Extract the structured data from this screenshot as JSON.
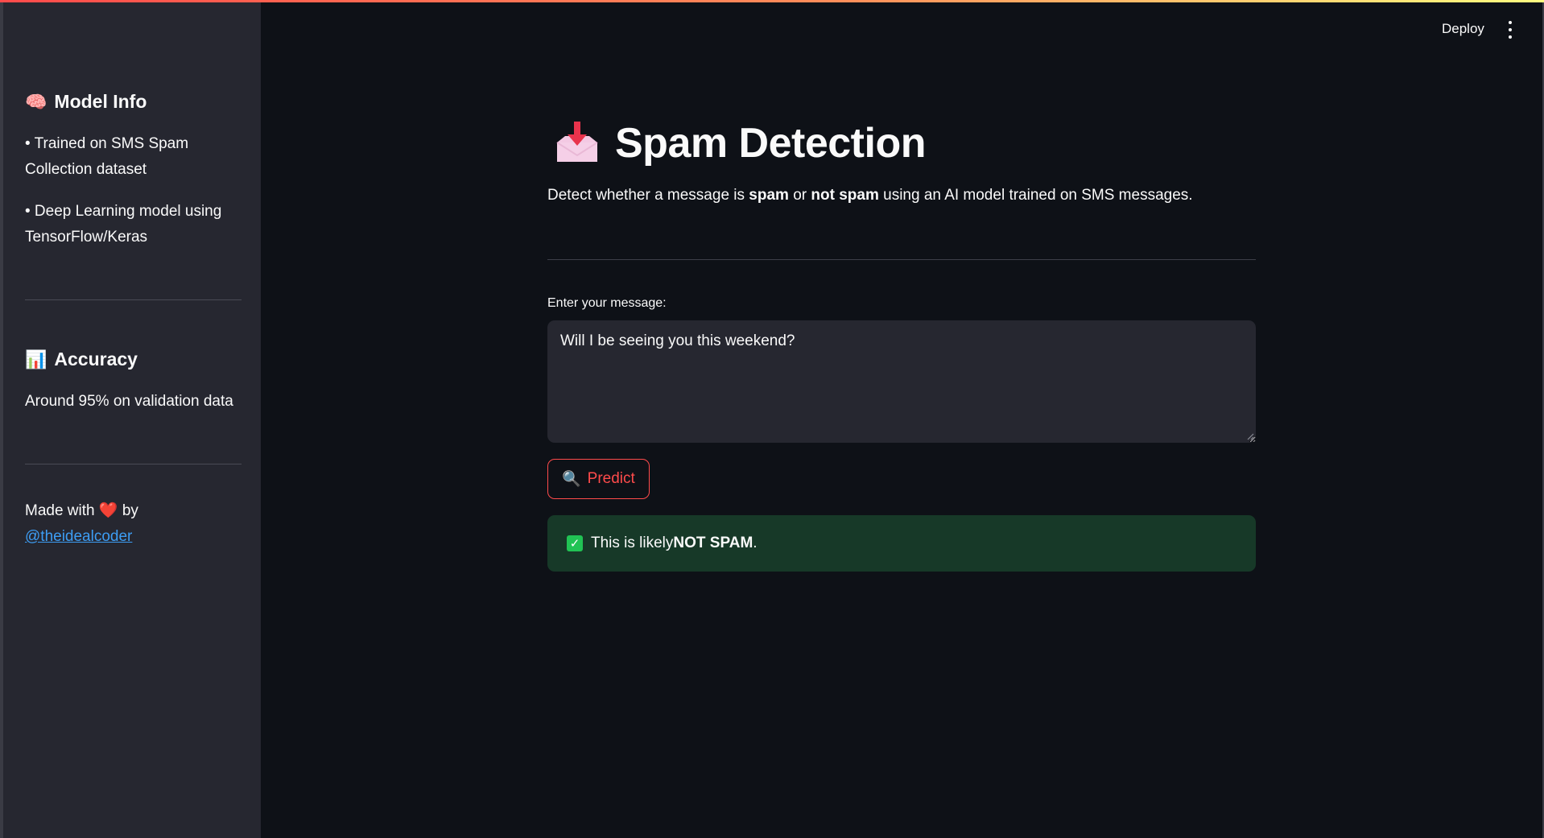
{
  "header": {
    "deploy_label": "Deploy",
    "menu_icon": "kebab-menu-icon"
  },
  "sidebar": {
    "model_info": {
      "icon": "brain-icon",
      "heading": "Model Info",
      "bullets": [
        "• Trained on SMS Spam Collection dataset",
        "• Deep Learning model using TensorFlow/Keras"
      ]
    },
    "accuracy": {
      "icon": "bar-chart-icon",
      "heading": "Accuracy",
      "text": "Around 95% on validation data"
    },
    "footer": {
      "prefix": "Made with",
      "heart_icon": "heart-icon",
      "suffix": "by",
      "link_text": "@theidealcoder"
    }
  },
  "main": {
    "title_icon": "inbox-tray-icon",
    "title": "Spam Detection",
    "subtitle": {
      "part1": "Detect whether a message is ",
      "bold1": "spam",
      "part2": " or ",
      "bold2": "not spam",
      "part3": " using an AI model trained on SMS messages."
    },
    "input": {
      "label": "Enter your message:",
      "value": "Will I be seeing you this weekend?"
    },
    "predict_button": {
      "icon": "magnifier-icon",
      "label": "Predict"
    },
    "result": {
      "icon": "check-mark-icon",
      "prefix": "This is likely ",
      "bold": "NOT SPAM",
      "suffix": "."
    }
  },
  "colors": {
    "background": "#0e1117",
    "sidebar": "#262730",
    "accent": "#ff4b4b",
    "success_bg": "#173928",
    "success_check": "#21c354",
    "link": "#3d9df3"
  }
}
